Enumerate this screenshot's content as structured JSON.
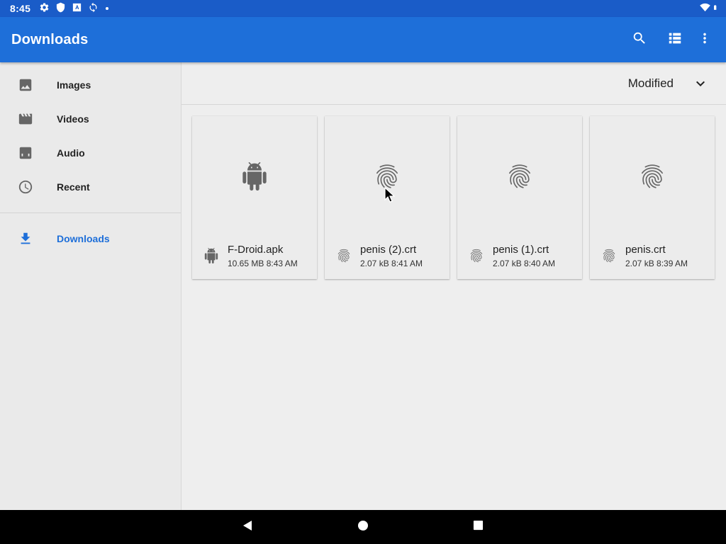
{
  "status_bar": {
    "time": "8:45",
    "icons": [
      "settings-icon",
      "shield-icon",
      "a-icon",
      "sync-icon",
      "dot-icon"
    ],
    "right_icons": [
      "wifi-icon",
      "battery-icon"
    ]
  },
  "app_bar": {
    "title": "Downloads",
    "actions": [
      "search-icon",
      "list-view-icon",
      "more-vert-icon"
    ]
  },
  "sidebar": {
    "items": [
      {
        "label": "Images",
        "icon": "image-icon"
      },
      {
        "label": "Videos",
        "icon": "movie-icon"
      },
      {
        "label": "Audio",
        "icon": "headphones-icon"
      },
      {
        "label": "Recent",
        "icon": "clock-icon"
      }
    ],
    "downloads": {
      "label": "Downloads",
      "icon": "download-icon",
      "active": true
    }
  },
  "sort": {
    "label": "Modified",
    "icon": "chevron-down-icon"
  },
  "files": [
    {
      "name": "F-Droid.apk",
      "meta": "10.65 MB 8:43 AM",
      "icon": "android-icon"
    },
    {
      "name": "penis (2).crt",
      "meta": "2.07 kB 8:41 AM",
      "icon": "fingerprint-icon"
    },
    {
      "name": "penis (1).crt",
      "meta": "2.07 kB 8:40 AM",
      "icon": "fingerprint-icon"
    },
    {
      "name": "penis.crt",
      "meta": "2.07 kB 8:39 AM",
      "icon": "fingerprint-icon"
    }
  ],
  "colors": {
    "accent": "#1e6fd9",
    "status_bar": "#1a5cc8",
    "icon_gray": "#666666",
    "background": "#eeeeee"
  },
  "nav_bar": [
    "back-icon",
    "home-icon",
    "recents-icon"
  ]
}
